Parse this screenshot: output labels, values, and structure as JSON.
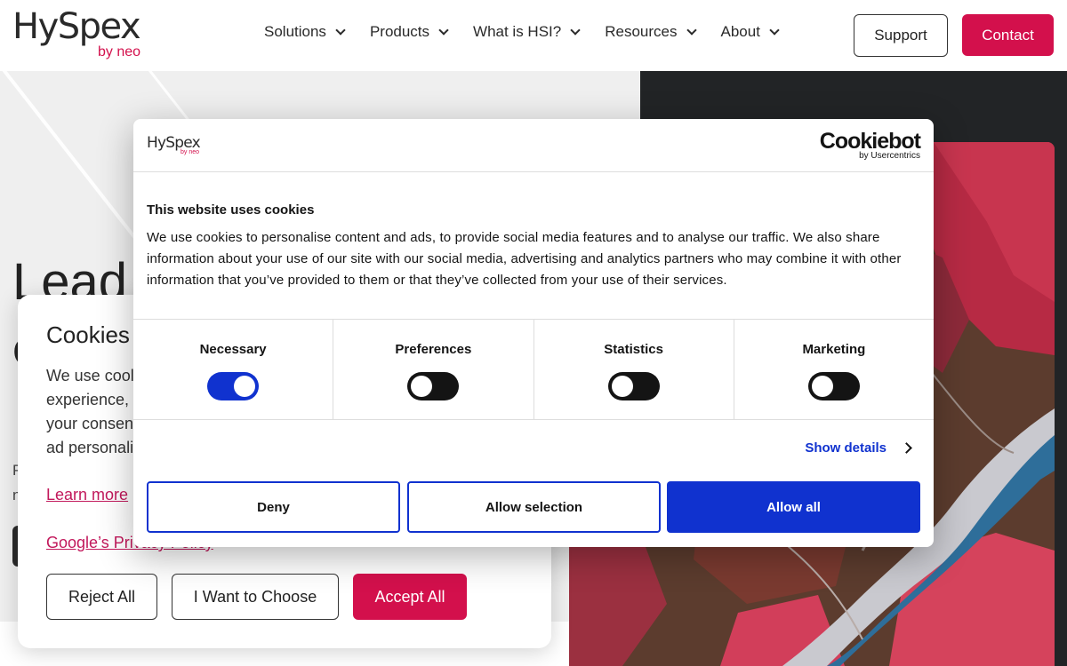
{
  "header": {
    "logo_main": "HySpex",
    "logo_sub": "by neo",
    "nav": [
      {
        "label": "Solutions"
      },
      {
        "label": "Products"
      },
      {
        "label": "What is HSI?"
      },
      {
        "label": "Resources"
      },
      {
        "label": "About"
      }
    ],
    "support_label": "Support",
    "contact_label": "Contact"
  },
  "hero": {
    "title_fragment": "Lead",
    "title_fragment2": "C",
    "para_fragment1": "P",
    "para_fragment2": "n"
  },
  "site_cookie_card": {
    "title": "Cookies",
    "text_lines": [
      "We use cool",
      "experience,",
      "your consen",
      "ad personali"
    ],
    "learn_more": "Learn more",
    "privacy_link": "Google’s Privacy Policy",
    "reject_label": "Reject All",
    "choose_label": "I Want to Choose",
    "accept_label": "Accept All"
  },
  "cookiebot": {
    "logo_main": "HySpex",
    "logo_sub": "by neo",
    "brand_main": "Cookiebot",
    "brand_sub": "by Usercentrics",
    "title": "This website uses cookies",
    "text": "We use cookies to personalise content and ads, to provide social media features and to analyse our traffic. We also share information about your use of our site with our social media, advertising and analytics partners who may combine it with other information that you’ve provided to them or that they’ve collected from your use of their services.",
    "toggles": [
      {
        "label": "Necessary",
        "on": true
      },
      {
        "label": "Preferences",
        "on": false
      },
      {
        "label": "Statistics",
        "on": false
      },
      {
        "label": "Marketing",
        "on": false
      }
    ],
    "show_details": "Show details",
    "deny_label": "Deny",
    "allow_selection_label": "Allow selection",
    "allow_all_label": "Allow all"
  },
  "colors": {
    "brand": "#d3104c",
    "cookiebot_blue": "#1032cf"
  }
}
